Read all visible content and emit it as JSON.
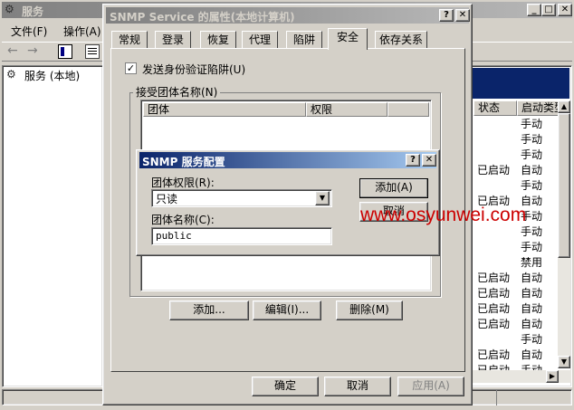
{
  "main": {
    "title": "服务",
    "menu": [
      "文件(F)",
      "操作(A)"
    ],
    "tree_item": "服务 (本地)",
    "header_status": "状态",
    "header_start": "启动类型",
    "rows": [
      {
        "status": "",
        "start": "手动"
      },
      {
        "status": "",
        "start": "手动"
      },
      {
        "status": "",
        "start": "手动"
      },
      {
        "status": "已启动",
        "start": "自动"
      },
      {
        "status": "",
        "start": "手动"
      },
      {
        "status": "已启动",
        "start": "自动"
      },
      {
        "status": "",
        "start": "手动"
      },
      {
        "status": "",
        "start": "手动"
      },
      {
        "status": "",
        "start": "手动"
      },
      {
        "status": "",
        "start": "禁用"
      },
      {
        "status": "已启动",
        "start": "自动"
      },
      {
        "status": "已启动",
        "start": "自动"
      },
      {
        "status": "已启动",
        "start": "自动"
      },
      {
        "status": "已启动",
        "start": "自动"
      },
      {
        "status": "",
        "start": "手动"
      },
      {
        "status": "已启动",
        "start": "自动"
      },
      {
        "status": "已启动",
        "start": "手动"
      }
    ]
  },
  "props": {
    "title": "SNMP Service 的属性(本地计算机)",
    "tabs": [
      "常规",
      "登录",
      "恢复",
      "代理",
      "陷阱",
      "安全",
      "依存关系"
    ],
    "send_trap_label": "发送身份验证陷阱(U)",
    "accepted_label": "接受团体名称(N)",
    "col_community": "团体",
    "col_rights": "权限",
    "add_btn": "添加...",
    "edit_btn": "编辑(I)...",
    "delete_btn": "删除(M)",
    "ok_btn": "确定",
    "cancel_btn": "取消",
    "apply_btn": "应用(A)"
  },
  "snmp": {
    "title": "SNMP 服务配置",
    "rights_label": "团体权限(R):",
    "rights_value": "只读",
    "name_label": "团体名称(C):",
    "name_value": "public",
    "add_btn": "添加(A)",
    "cancel_btn": "取消"
  },
  "watermark": "www.osyunwei.com",
  "colors": {
    "active_title": "#0a246a",
    "watermark": "#cc0000"
  }
}
